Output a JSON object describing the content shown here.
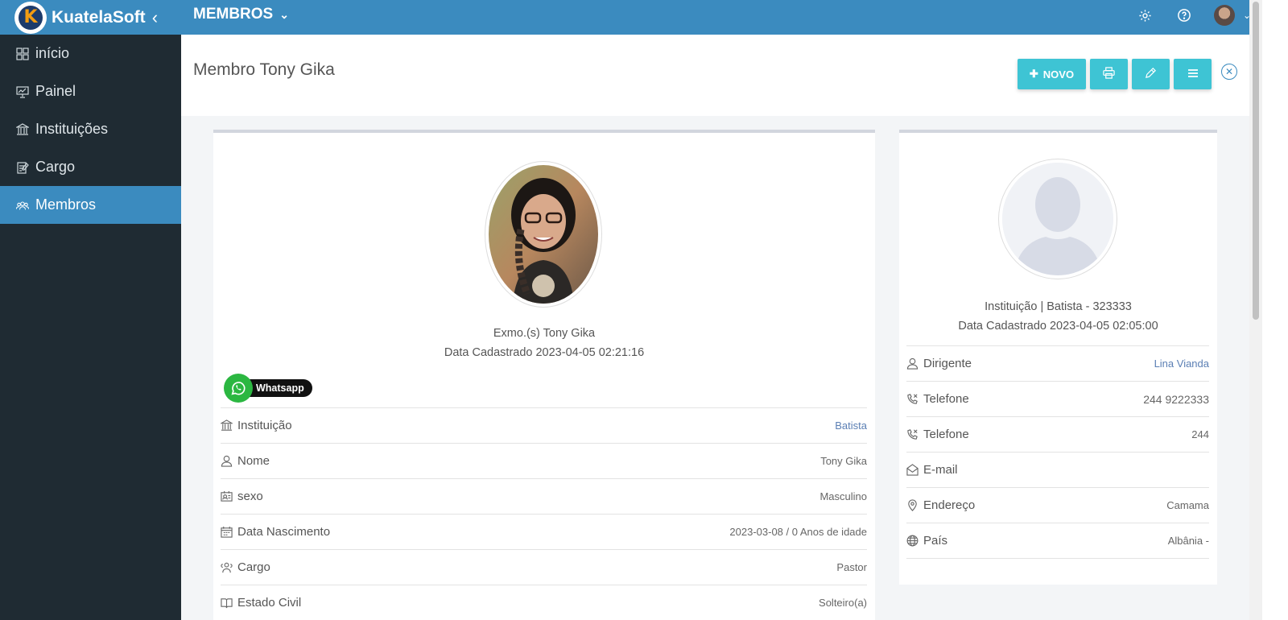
{
  "brand": {
    "name": "KuatelaSoft",
    "logo_letter": "K"
  },
  "header": {
    "module": "MEMBROS"
  },
  "sidebar": {
    "items": [
      {
        "label": "início",
        "icon": "dashboard-grid-icon",
        "active": false
      },
      {
        "label": "Painel",
        "icon": "presentation-board-icon",
        "active": false
      },
      {
        "label": "Instituições",
        "icon": "institution-building-icon",
        "active": false
      },
      {
        "label": "Cargo",
        "icon": "notepad-icon",
        "active": false
      },
      {
        "label": "Membros",
        "icon": "users-group-icon",
        "active": true
      }
    ]
  },
  "page": {
    "title": "Membro Tony Gika",
    "actions": {
      "new_label": "NOVO"
    }
  },
  "member": {
    "greeting": "Exmo.(s) Tony Gika",
    "registered": "Data Cadastrado 2023-04-05 02:21:16",
    "whatsapp_label": "Whatsapp",
    "rows": [
      {
        "label": "Instituição",
        "value": "Batista"
      },
      {
        "label": "Nome",
        "value": "Tony Gika"
      },
      {
        "label": "sexo",
        "value": "Masculino"
      },
      {
        "label": "Data Nascimento",
        "value": "2023-03-08 / 0 Anos de idade"
      },
      {
        "label": "Cargo",
        "value": "Pastor"
      },
      {
        "label": "Estado Civil",
        "value": "Solteiro(a)"
      }
    ]
  },
  "institution": {
    "line1": "Instituição | Batista - 323333",
    "line2": "Data Cadastrado 2023-04-05 02:05:00",
    "rows": [
      {
        "label": "Dirigente",
        "value": "Lina Vianda"
      },
      {
        "label": "Telefone",
        "value": "244 9222333"
      },
      {
        "label": "Telefone",
        "value": "244"
      },
      {
        "label": "E-mail",
        "value": ""
      },
      {
        "label": "Endereço",
        "value": "Camama"
      },
      {
        "label": "País",
        "value": "Albânia -"
      }
    ]
  },
  "colors": {
    "primary": "#3b8bbf",
    "sidebar": "#1f2b33",
    "action": "#3ec4d4",
    "whatsapp": "#2bb741"
  }
}
